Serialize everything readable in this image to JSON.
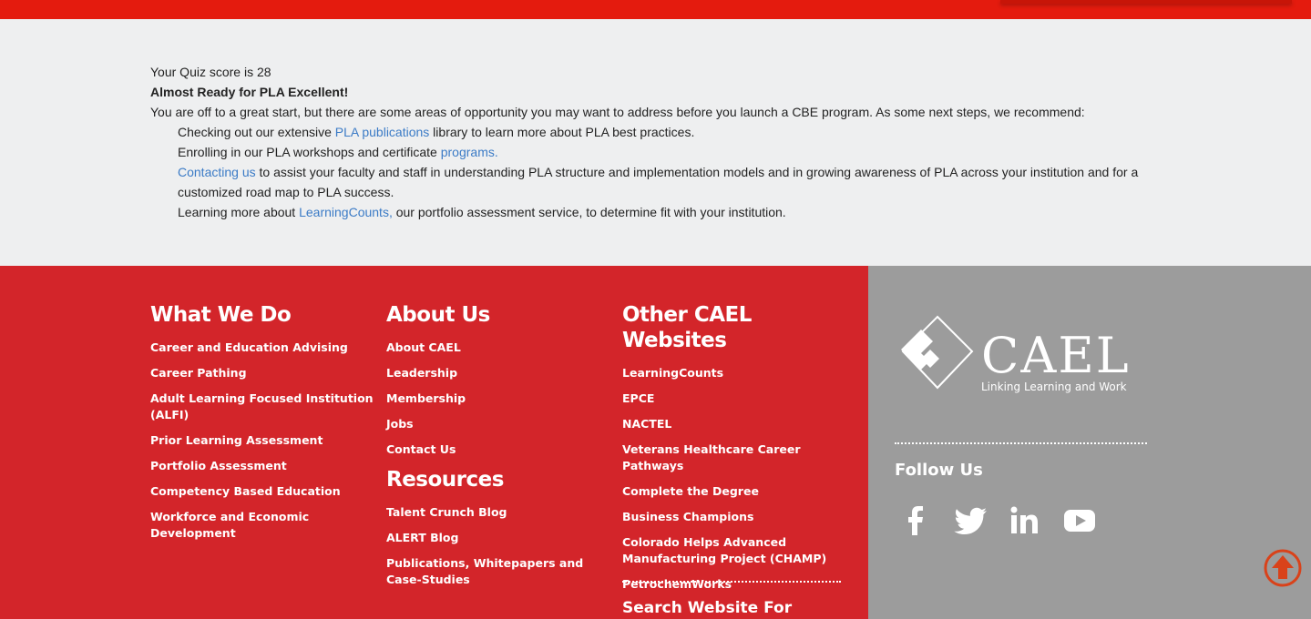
{
  "quiz": {
    "score_line": "Your Quiz score is 28",
    "headline": "Almost Ready for PLA Excellent!",
    "intro": "You are off to a great start, but there are some areas of opportunity you may want to address before you launch a CBE program. As some next steps, we recommend:",
    "item1_pre": "Checking out our extensive ",
    "item1_link": "PLA publications",
    "item1_post": " library to learn more about PLA best practices.",
    "item2_pre": "Enrolling in our PLA workshops and certificate ",
    "item2_link": "programs.",
    "item3_link": "Contacting us",
    "item3_post_line1": " to assist your faculty and staff in understanding PLA structure and implementation models and in growing awareness of PLA across your institution and for a",
    "item3_post_line2": "customized road map to PLA success.",
    "item4_pre": "Learning more about ",
    "item4_link": "LearningCounts,",
    "item4_post": " our portfolio assessment service, to determine fit with your institution."
  },
  "footer": {
    "what_we_do": {
      "title": "What We Do",
      "items": [
        "Career and Education Advising",
        "Career Pathing",
        "Adult Learning Focused Institution (ALFI)",
        "Prior Learning Assessment",
        "Portfolio Assessment",
        "Competency Based Education",
        "Workforce and Economic Development"
      ]
    },
    "about_us": {
      "title": "About Us",
      "items": [
        "About CAEL",
        "Leadership",
        "Membership",
        "Jobs",
        "Contact Us"
      ]
    },
    "resources": {
      "title": "Resources",
      "items": [
        "Talent Crunch Blog",
        "ALERT Blog",
        "Publications, Whitepapers and Case-Studies"
      ]
    },
    "other_sites": {
      "title": "Other CAEL Websites",
      "items": [
        "LearningCounts",
        "EPCE",
        "NACTEL",
        "Veterans Healthcare Career Pathways",
        "Complete the Degree",
        "Business Champions",
        "Colorado Helps Advanced Manufacturing Project (CHAMP)",
        "PetrochemWorks"
      ]
    },
    "search_title": "Search Website For",
    "logo_text": "CAEL",
    "logo_tagline": "Linking Learning and Work",
    "follow_us": "Follow Us",
    "social_icons": [
      "facebook-icon",
      "twitter-icon",
      "linkedin-icon",
      "youtube-icon"
    ]
  },
  "colors": {
    "top_bar": "#e41b0e",
    "footer_red": "#d3252a",
    "footer_grey": "#9c9c9c",
    "link": "#3b7bc6",
    "scroll_top": "#d9421a"
  }
}
